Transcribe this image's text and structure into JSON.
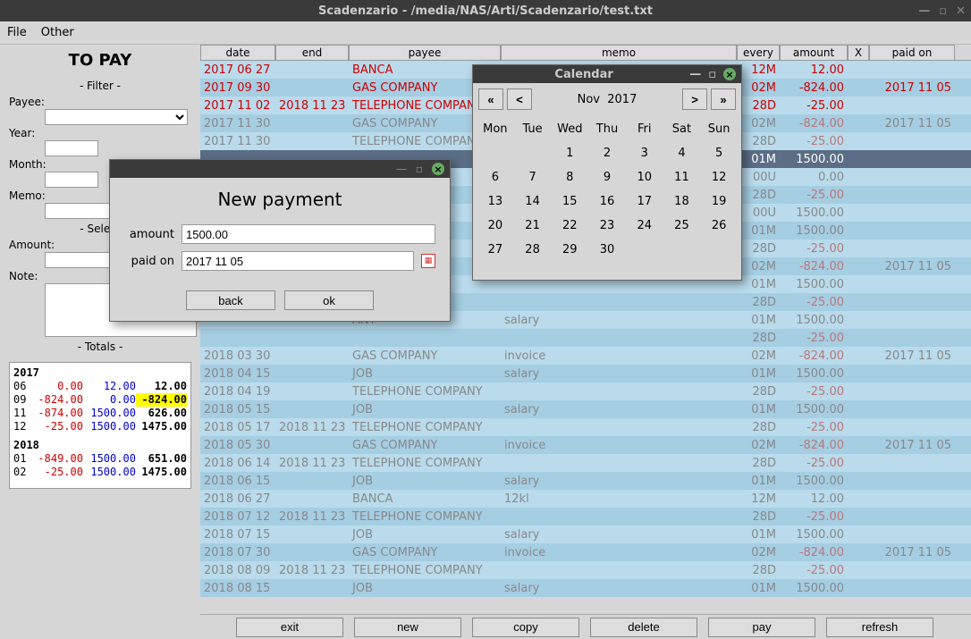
{
  "window": {
    "title": "Scadenzario - /media/NAS/Arti/Scadenzario/test.txt"
  },
  "menubar": {
    "file": "File",
    "other": "Other"
  },
  "leftpanel": {
    "title": "TO PAY",
    "filter_label": "- Filter -",
    "payee_label": "Payee:",
    "year_label": "Year:",
    "month_label": "Month:",
    "memo_label": "Memo:",
    "select_label": "- Select",
    "amount_label": "Amount:",
    "note_label": "Note:",
    "totals_label": "- Totals -"
  },
  "totals": {
    "years": [
      {
        "year": "2017",
        "rows": [
          {
            "mon": "06",
            "neg": "0.00",
            "pos": "12.00",
            "tot": "12.00"
          },
          {
            "mon": "09",
            "neg": "-824.00",
            "pos": "0.00",
            "tot": "-824.00",
            "hl": true
          },
          {
            "mon": "11",
            "neg": "-874.00",
            "pos": "1500.00",
            "tot": "626.00"
          },
          {
            "mon": "12",
            "neg": "-25.00",
            "pos": "1500.00",
            "tot": "1475.00"
          }
        ]
      },
      {
        "year": "2018",
        "rows": [
          {
            "mon": "01",
            "neg": "-849.00",
            "pos": "1500.00",
            "tot": "651.00"
          },
          {
            "mon": "02",
            "neg": "-25.00",
            "pos": "1500.00",
            "tot": "1475.00"
          }
        ]
      }
    ]
  },
  "headers": {
    "date": "date",
    "end": "end",
    "payee": "payee",
    "memo": "memo",
    "every": "every",
    "amount": "amount",
    "x": "X",
    "paidon": "paid on"
  },
  "rows": [
    {
      "date": "2017 06 27",
      "end": "",
      "payee": "BANCA",
      "memo": "",
      "every": "12M",
      "amount": "12.00",
      "paidon": "",
      "style": "red",
      "alt": 0
    },
    {
      "date": "2017 09 30",
      "end": "",
      "payee": "GAS COMPANY",
      "memo": "",
      "every": "02M",
      "amount": "-824.00",
      "paidon": "2017 11 05",
      "style": "red",
      "alt": 1
    },
    {
      "date": "2017 11 02",
      "end": "2018 11 23",
      "payee": "TELEPHONE COMPAN",
      "memo": "",
      "every": "28D",
      "amount": "-25.00",
      "paidon": "",
      "style": "red",
      "alt": 0
    },
    {
      "date": "2017 11 30",
      "end": "",
      "payee": "GAS COMPANY",
      "memo": "",
      "every": "02M",
      "amount": "-824.00",
      "paidon": "2017 11 05",
      "style": "dim",
      "alt": 1
    },
    {
      "date": "2017 11 30",
      "end": "",
      "payee": "TELEPHONE COMPAN",
      "memo": "",
      "every": "28D",
      "amount": "-25.00",
      "paidon": "",
      "style": "dim",
      "alt": 0
    },
    {
      "date": "",
      "end": "",
      "payee": "",
      "memo": "",
      "every": "01M",
      "amount": "1500.00",
      "paidon": "",
      "style": "sel",
      "alt": 0
    },
    {
      "date": "",
      "end": "",
      "payee": "",
      "memo": "",
      "every": "00U",
      "amount": "0.00",
      "paidon": "",
      "style": "dim",
      "alt": 0
    },
    {
      "date": "",
      "end": "",
      "payee": "",
      "memo": "",
      "every": "28D",
      "amount": "-25.00",
      "paidon": "",
      "style": "dim",
      "alt": 1
    },
    {
      "date": "",
      "end": "",
      "payee": "",
      "memo": "",
      "every": "00U",
      "amount": "1500.00",
      "paidon": "",
      "style": "dim",
      "alt": 0
    },
    {
      "date": "",
      "end": "",
      "payee": "",
      "memo": "",
      "every": "01M",
      "amount": "1500.00",
      "paidon": "",
      "style": "dim",
      "alt": 1
    },
    {
      "date": "",
      "end": "",
      "payee": "",
      "memo": "",
      "every": "28D",
      "amount": "-25.00",
      "paidon": "",
      "style": "dim",
      "alt": 0
    },
    {
      "date": "",
      "end": "",
      "payee": "",
      "memo": "",
      "every": "02M",
      "amount": "-824.00",
      "paidon": "2017 11 05",
      "style": "dim",
      "alt": 1
    },
    {
      "date": "",
      "end": "",
      "payee": "",
      "memo": "",
      "every": "01M",
      "amount": "1500.00",
      "paidon": "",
      "style": "dim",
      "alt": 0
    },
    {
      "date": "",
      "end": "",
      "payee": "",
      "memo": "",
      "every": "28D",
      "amount": "-25.00",
      "paidon": "",
      "style": "dim",
      "alt": 1
    },
    {
      "date": "",
      "end": "",
      "payee": "ANY",
      "memo": "salary",
      "every": "01M",
      "amount": "1500.00",
      "paidon": "",
      "style": "dim",
      "alt": 0
    },
    {
      "date": "",
      "end": "",
      "payee": "",
      "memo": "",
      "every": "28D",
      "amount": "-25.00",
      "paidon": "",
      "style": "dim",
      "alt": 1
    },
    {
      "date": "2018 03 30",
      "end": "",
      "payee": "GAS COMPANY",
      "memo": "invoice",
      "every": "02M",
      "amount": "-824.00",
      "paidon": "2017 11 05",
      "style": "dim",
      "alt": 0
    },
    {
      "date": "2018 04 15",
      "end": "",
      "payee": "JOB",
      "memo": "salary",
      "every": "01M",
      "amount": "1500.00",
      "paidon": "",
      "style": "dim",
      "alt": 1
    },
    {
      "date": "2018 04 19",
      "end": "",
      "payee": "TELEPHONE COMPANY",
      "memo": "",
      "every": "28D",
      "amount": "-25.00",
      "paidon": "",
      "style": "dim",
      "alt": 0
    },
    {
      "date": "2018 05 15",
      "end": "",
      "payee": "JOB",
      "memo": "salary",
      "every": "01M",
      "amount": "1500.00",
      "paidon": "",
      "style": "dim",
      "alt": 1
    },
    {
      "date": "2018 05 17",
      "end": "2018 11 23",
      "payee": "TELEPHONE COMPANY",
      "memo": "",
      "every": "28D",
      "amount": "-25.00",
      "paidon": "",
      "style": "dim",
      "alt": 0
    },
    {
      "date": "2018 05 30",
      "end": "",
      "payee": "GAS COMPANY",
      "memo": "invoice",
      "every": "02M",
      "amount": "-824.00",
      "paidon": "2017 11 05",
      "style": "dim",
      "alt": 1
    },
    {
      "date": "2018 06 14",
      "end": "2018 11 23",
      "payee": "TELEPHONE COMPANY",
      "memo": "",
      "every": "28D",
      "amount": "-25.00",
      "paidon": "",
      "style": "dim",
      "alt": 0
    },
    {
      "date": "2018 06 15",
      "end": "",
      "payee": "JOB",
      "memo": "salary",
      "every": "01M",
      "amount": "1500.00",
      "paidon": "",
      "style": "dim",
      "alt": 1
    },
    {
      "date": "2018 06 27",
      "end": "",
      "payee": "BANCA",
      "memo": "12kl",
      "every": "12M",
      "amount": "12.00",
      "paidon": "",
      "style": "dim",
      "alt": 0
    },
    {
      "date": "2018 07 12",
      "end": "2018 11 23",
      "payee": "TELEPHONE COMPANY",
      "memo": "",
      "every": "28D",
      "amount": "-25.00",
      "paidon": "",
      "style": "dim",
      "alt": 1
    },
    {
      "date": "2018 07 15",
      "end": "",
      "payee": "JOB",
      "memo": "salary",
      "every": "01M",
      "amount": "1500.00",
      "paidon": "",
      "style": "dim",
      "alt": 0
    },
    {
      "date": "2018 07 30",
      "end": "",
      "payee": "GAS COMPANY",
      "memo": "invoice",
      "every": "02M",
      "amount": "-824.00",
      "paidon": "2017 11 05",
      "style": "dim",
      "alt": 1
    },
    {
      "date": "2018 08 09",
      "end": "2018 11 23",
      "payee": "TELEPHONE COMPANY",
      "memo": "",
      "every": "28D",
      "amount": "-25.00",
      "paidon": "",
      "style": "dim",
      "alt": 0
    },
    {
      "date": "2018 08 15",
      "end": "",
      "payee": "JOB",
      "memo": "salary",
      "every": "01M",
      "amount": "1500.00",
      "paidon": "",
      "style": "dim",
      "alt": 1
    }
  ],
  "bottombar": {
    "exit": "exit",
    "new": "new",
    "copy": "copy",
    "delete": "delete",
    "pay": "pay",
    "refresh": "refresh"
  },
  "newpay": {
    "title": "New payment",
    "amount_label": "amount",
    "amount_value": "1500.00",
    "paidon_label": "paid on",
    "paidon_value": "2017 11 05",
    "back": "back",
    "ok": "ok"
  },
  "calendar": {
    "title": "Calendar",
    "nav": {
      "first": "«",
      "prev": "<",
      "month": "Nov",
      "year": "2017",
      "next": ">",
      "last": "»"
    },
    "days": [
      "Mon",
      "Tue",
      "Wed",
      "Thu",
      "Fri",
      "Sat",
      "Sun"
    ],
    "weeks": [
      [
        "",
        "",
        "1",
        "2",
        "3",
        "4",
        "5"
      ],
      [
        "6",
        "7",
        "8",
        "9",
        "10",
        "11",
        "12"
      ],
      [
        "13",
        "14",
        "15",
        "16",
        "17",
        "18",
        "19"
      ],
      [
        "20",
        "21",
        "22",
        "23",
        "24",
        "25",
        "26"
      ],
      [
        "27",
        "28",
        "29",
        "30",
        "",
        "",
        ""
      ]
    ]
  }
}
